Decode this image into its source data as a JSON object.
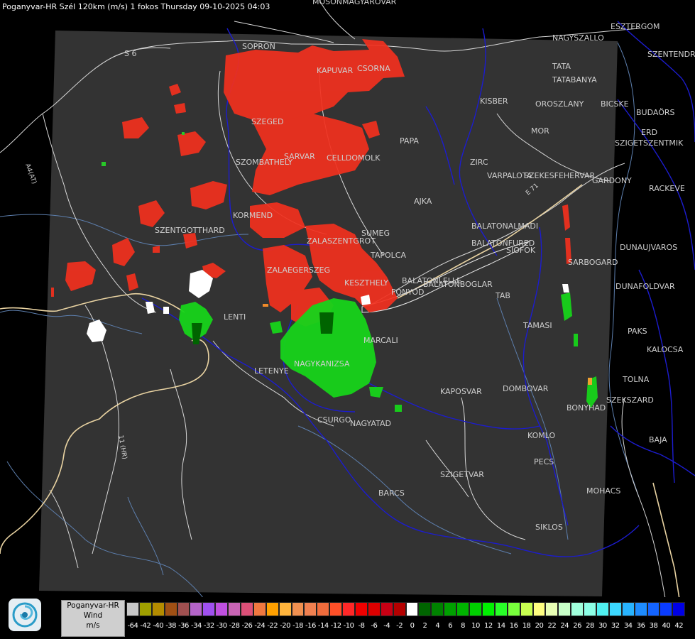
{
  "title": "Poganyvar-HR Szél 120km (m/s) 1 fokos Thursday 09-10-2025 04:03",
  "colors": {
    "background": "#000000",
    "radar_area": "#333333",
    "country_border": "#1a1acc",
    "road_white": "#e0e0e0",
    "road_tan": "#e8d2a0",
    "river": "#6b8fbf"
  },
  "cities": [
    "MOSONMAGYARÓVÁR",
    "ESZTERGOM",
    "NAGYSZALLO",
    "SZENTENDRE",
    "S 6",
    "SOPRON",
    "KAPUVAR",
    "CSORNA",
    "TATA",
    "TATABANYA",
    "KISBER",
    "OROSZLANY",
    "BICSKE",
    "BUDAÖRS",
    "SZEGED",
    "MOR",
    "ERD",
    "SZIGETSZENTMIK",
    "PAPA",
    "SZOMBATHELY",
    "SARVAR",
    "CELLDOMOLK",
    "ZIRC",
    "VARPALOTA",
    "SZEKESFEHERVAR",
    "GARDONY",
    "AJKA",
    "RACKEVE",
    "KORMEND",
    "SZENTGOTTHARD",
    "BALATONALMADI",
    "SUMEG",
    "ZALASZENTGROT",
    "BALATONFURED",
    "DUNAUJVAROS",
    "TAPOLCA",
    "SIOFOK",
    "SARBOGARD",
    "ZALAEGERSZEG",
    "KESZTHELY",
    "BALATONLELLE",
    "FONYOD",
    "BALATONBOGLAR",
    "DUNAFOLDVAR",
    "TAB",
    "LENTI",
    "TAMASI",
    "PAKS",
    "MARCALI",
    "KALOCSA",
    "LETENYE",
    "NAGYKANIZSA",
    "TOLNA",
    "KAPOSVAR",
    "DOMBOVAR",
    "SZEKSZARD",
    "BONYHAD",
    "CSURGO",
    "NAGYATAD",
    "KOMLO",
    "BAJA",
    "PECS",
    "SZIGETVAR",
    "MOHACS",
    "BARCS",
    "SIKLOS"
  ],
  "roads": [
    "A4(AT)",
    "11 (HR)",
    "E 71"
  ],
  "legend": {
    "name": "Poganyvar-HR",
    "quantity": "Wind",
    "unit": "m/s",
    "bins": [
      {
        "label": "-64",
        "color": "#c8c8c8"
      },
      {
        "label": "-42",
        "color": "#a0a000"
      },
      {
        "label": "-40",
        "color": "#b48c00"
      },
      {
        "label": "-38",
        "color": "#a05014"
      },
      {
        "label": "-36",
        "color": "#a05050"
      },
      {
        "label": "-34",
        "color": "#b464c8"
      },
      {
        "label": "-32",
        "color": "#a050f0"
      },
      {
        "label": "-30",
        "color": "#c050e0"
      },
      {
        "label": "-28",
        "color": "#c864b4"
      },
      {
        "label": "-26",
        "color": "#dc5078"
      },
      {
        "label": "-24",
        "color": "#f07840"
      },
      {
        "label": "-22",
        "color": "#ffa000"
      },
      {
        "label": "-20",
        "color": "#ffb43c"
      },
      {
        "label": "-18",
        "color": "#f09050"
      },
      {
        "label": "-16",
        "color": "#f08050"
      },
      {
        "label": "-14",
        "color": "#f06c3c"
      },
      {
        "label": "-12",
        "color": "#ff5028"
      },
      {
        "label": "-10",
        "color": "#ff2828"
      },
      {
        "label": "-8",
        "color": "#f00000"
      },
      {
        "label": "-6",
        "color": "#dc0000"
      },
      {
        "label": "-4",
        "color": "#c80014"
      },
      {
        "label": "-2",
        "color": "#b40000"
      },
      {
        "label": "0",
        "color": "#ffffff"
      },
      {
        "label": "2",
        "color": "#006400"
      },
      {
        "label": "4",
        "color": "#008200"
      },
      {
        "label": "6",
        "color": "#00a000"
      },
      {
        "label": "8",
        "color": "#00b400"
      },
      {
        "label": "10",
        "color": "#00d000"
      },
      {
        "label": "12",
        "color": "#00f000"
      },
      {
        "label": "14",
        "color": "#28ff28"
      },
      {
        "label": "16",
        "color": "#78ff3c"
      },
      {
        "label": "18",
        "color": "#c8ff50"
      },
      {
        "label": "20",
        "color": "#ffff80"
      },
      {
        "label": "22",
        "color": "#e8ffb4"
      },
      {
        "label": "24",
        "color": "#c8ffc8"
      },
      {
        "label": "26",
        "color": "#a0ffdc"
      },
      {
        "label": "28",
        "color": "#8cffe6"
      },
      {
        "label": "30",
        "color": "#50f0f0"
      },
      {
        "label": "32",
        "color": "#3cd8ff"
      },
      {
        "label": "34",
        "color": "#28b4ff"
      },
      {
        "label": "36",
        "color": "#1e8cff"
      },
      {
        "label": "38",
        "color": "#1464ff"
      },
      {
        "label": "40",
        "color": "#0a3cff"
      },
      {
        "label": "42",
        "color": "#0000e6"
      }
    ]
  },
  "logo_icon": "swirl-logo-icon"
}
